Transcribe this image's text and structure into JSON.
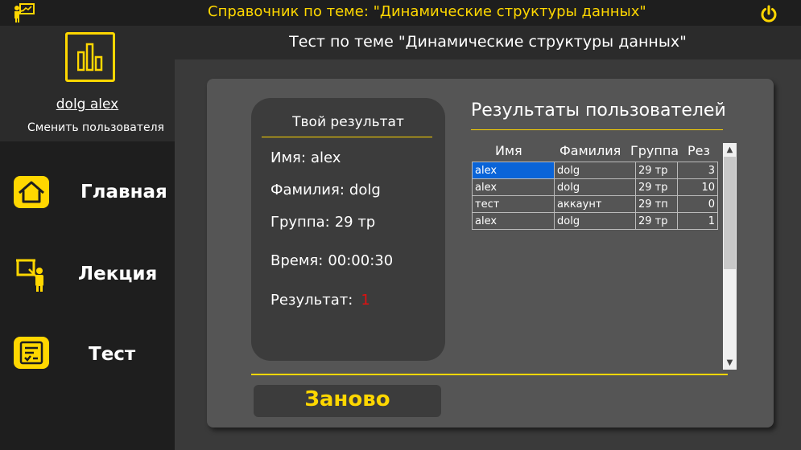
{
  "app": {
    "title": "Справочник по теме: \"Динамические структуры данных\"",
    "accent_color": "#ffd700",
    "icons": {
      "app": "presentation-icon",
      "power": "power-icon"
    }
  },
  "user": {
    "name": "dolg alex",
    "change_label": "Сменить пользователя",
    "avatar_icon": "bar-chart-icon"
  },
  "nav": {
    "items": [
      {
        "label": "Главная",
        "icon": "home-icon"
      },
      {
        "label": "Лекция",
        "icon": "lecture-icon"
      },
      {
        "label": "Тест",
        "icon": "checklist-icon"
      }
    ]
  },
  "header": {
    "title": "Тест по теме \"Динамические структуры данных\""
  },
  "result_card": {
    "title": "Твой результат",
    "fields": [
      {
        "label": "Имя:",
        "value": "alex"
      },
      {
        "label": "Фамилия:",
        "value": "dolg"
      },
      {
        "label": "Группа:",
        "value": "29 тр"
      },
      {
        "label": "Время:",
        "value": "00:00:30"
      },
      {
        "label": "Результат:",
        "value": "1",
        "value_color": "#e01010"
      }
    ]
  },
  "results": {
    "title": "Результаты пользователей",
    "columns": [
      "Имя",
      "Фамилия",
      "Группа",
      "Рез"
    ],
    "rows": [
      [
        "alex",
        "dolg",
        "29 тр",
        "3"
      ],
      [
        "alex",
        "dolg",
        "29 тр",
        "10"
      ],
      [
        "тест",
        "аккаунт",
        "29 тп",
        "0"
      ],
      [
        "alex",
        "dolg",
        "29 тр",
        "1"
      ]
    ],
    "selected_cell": "alex",
    "selection_color": "#0a64d8"
  },
  "actions": {
    "again_label": "Заново"
  }
}
